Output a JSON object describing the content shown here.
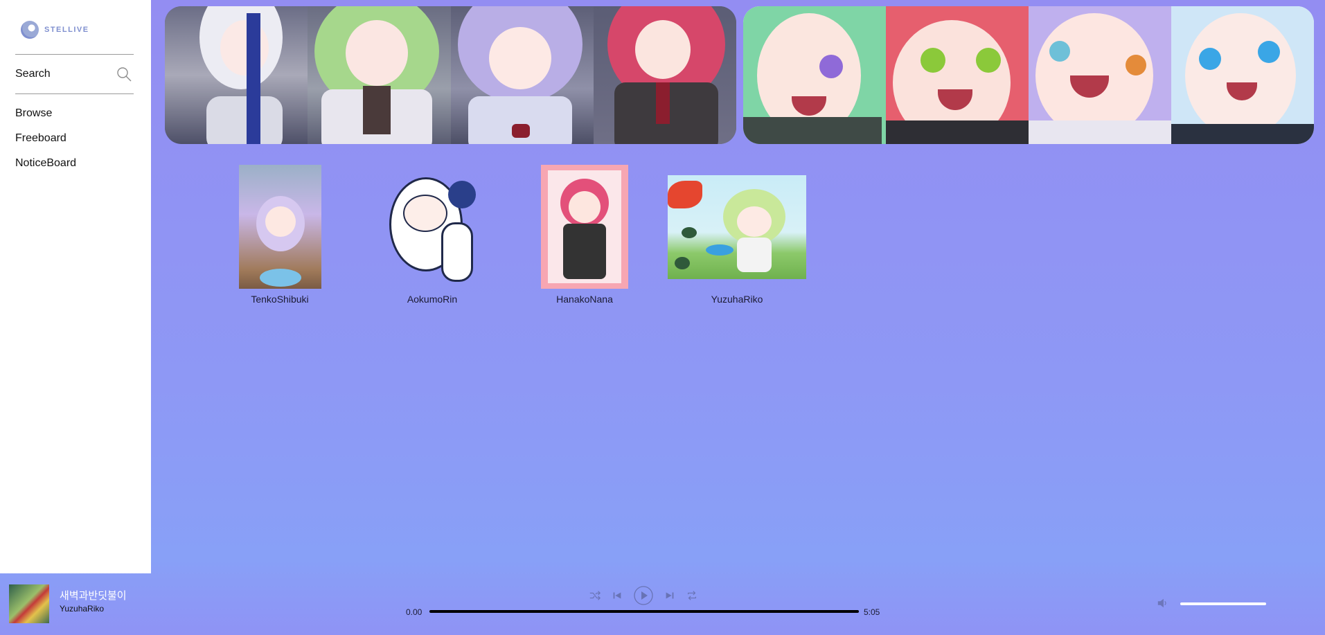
{
  "sidebar": {
    "logo_text": "STELLIVE",
    "search_label": "Search",
    "nav": [
      {
        "label": "Browse"
      },
      {
        "label": "Freeboard"
      },
      {
        "label": "NoticeBoard"
      }
    ]
  },
  "members": [
    {
      "name": "TenkoShibuki"
    },
    {
      "name": "AokumoRin"
    },
    {
      "name": "HanakoNana"
    },
    {
      "name": "YuzuhaRiko"
    }
  ],
  "player": {
    "track_title": "새벽과반딧불이",
    "track_artist": "YuzuhaRiko",
    "time_current": "0.00",
    "time_total": "5:05",
    "controls": [
      "shuffle-icon",
      "previous-icon",
      "play-icon",
      "next-icon",
      "repeat-icon"
    ],
    "volume_icon": "speaker-icon"
  },
  "colors": {
    "background": "#938df2",
    "sidebar": "#ffffff",
    "accent": "#7f8fcf"
  }
}
